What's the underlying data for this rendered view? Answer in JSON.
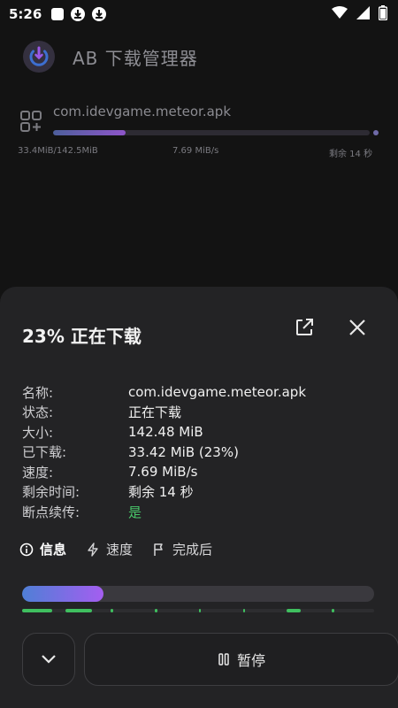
{
  "status_bar": {
    "time": "5:26",
    "left_icons": [
      "square-notification-icon",
      "download-notification-icon",
      "download-notification-icon"
    ],
    "right_icons": [
      "wifi-icon",
      "signal-icon",
      "battery-icon"
    ]
  },
  "app_bar": {
    "title": "AB 下载管理器",
    "logo_icon": "download-power-icon"
  },
  "download_item": {
    "file_name": "com.idevgame.meteor.apk",
    "progress_percent": 23,
    "size_text": "33.4MiB/142.5MiB",
    "speed_text": "7.69 MiB/s",
    "remaining_text": "剩余 14 秒"
  },
  "sheet": {
    "title": "23% 正在下载",
    "open_icon": "open-external-icon",
    "close_icon": "close-icon",
    "info": [
      {
        "key": "名称:",
        "value": "com.idevgame.meteor.apk"
      },
      {
        "key": "状态:",
        "value": "正在下载"
      },
      {
        "key": "大小:",
        "value": "142.48 MiB"
      },
      {
        "key": "已下载:",
        "value": "33.42 MiB (23%)"
      },
      {
        "key": "速度:",
        "value": "7.69 MiB/s"
      },
      {
        "key": "剩余时间:",
        "value": "剩余 14 秒"
      },
      {
        "key": "断点续传:",
        "value": "是"
      }
    ],
    "tabs": [
      {
        "label": "信息",
        "icon": "info-icon",
        "active": true
      },
      {
        "label": "速度",
        "icon": "lightning-icon",
        "active": false
      },
      {
        "label": "完成后",
        "icon": "flag-icon",
        "active": false
      }
    ],
    "progress_percent": 23,
    "segments_color": "#3fbf5f",
    "pause_label": "暂停",
    "accent_gradient": [
      "#4f7fd6",
      "#a45ef0"
    ]
  }
}
